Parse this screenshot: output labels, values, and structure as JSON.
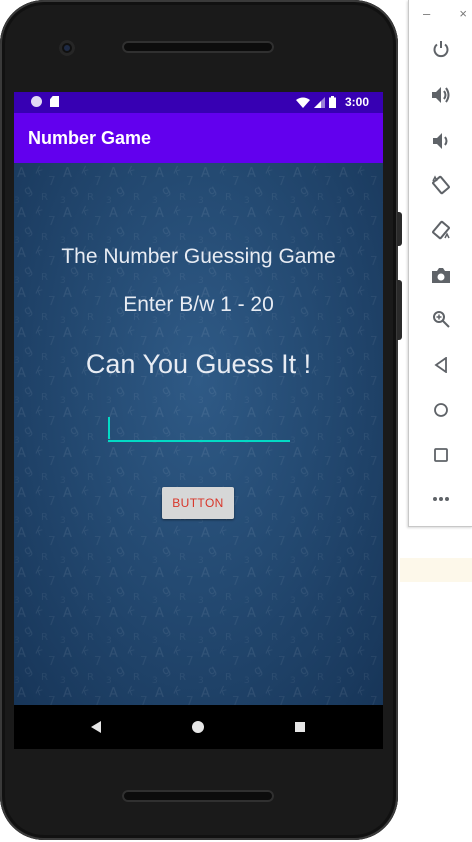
{
  "status_bar": {
    "time": "3:00"
  },
  "app_bar": {
    "title": "Number Game"
  },
  "main": {
    "heading": "The Number Guessing Game",
    "instruction": "Enter B/w 1 - 20",
    "prompt": "Can You Guess It !",
    "guess_input": {
      "value": "",
      "placeholder": ""
    },
    "button_label": "BUTTON"
  },
  "emulator_panel": {
    "minimize": "–",
    "close": "×",
    "controls": [
      "power",
      "volume-up",
      "volume-down",
      "rotate-left",
      "rotate-right",
      "screenshot",
      "zoom",
      "back",
      "home",
      "overview",
      "more"
    ]
  },
  "colors": {
    "status_bar": "#3700b3",
    "app_bar": "#6200ee",
    "accent": "#03dac5",
    "button_text": "#d8362a"
  }
}
